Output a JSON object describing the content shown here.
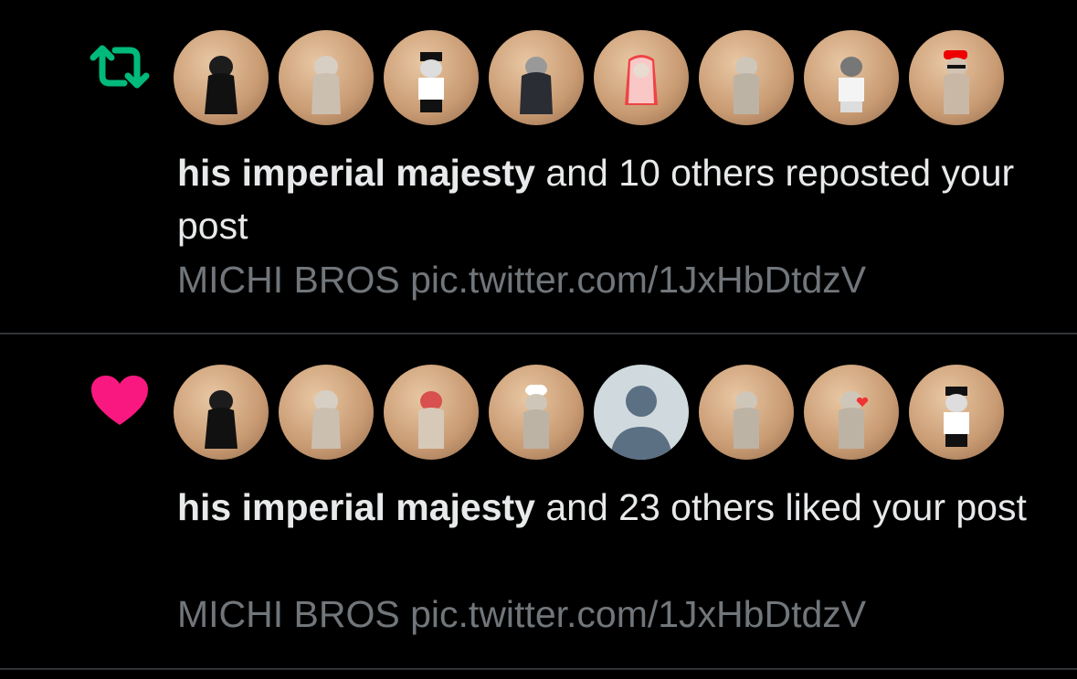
{
  "colors": {
    "repost": "#00ba7c",
    "like": "#f91880",
    "text": "#e7e9ea",
    "muted": "#71767b",
    "divider": "#2f3336"
  },
  "notifications": [
    {
      "type": "repost",
      "icon": "repost-icon",
      "actor": "his imperial majesty",
      "action_text": " and 10 others reposted your post",
      "preview": "MICHI BROS pic.twitter.com/1JxHbDtdzV",
      "avatar_count": 8
    },
    {
      "type": "like",
      "icon": "heart-icon",
      "actor": "his imperial majesty",
      "action_text": " and 23 others liked your post",
      "preview": "MICHI BROS pic.twitter.com/1JxHbDtdzV",
      "avatar_count": 8
    }
  ]
}
